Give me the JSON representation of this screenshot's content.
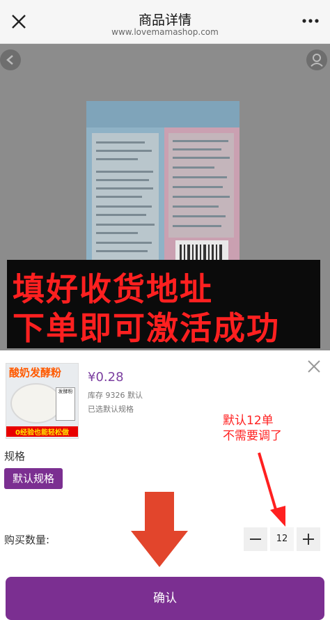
{
  "header": {
    "title": "商品详情",
    "subtitle": "www.lovemamashop.com"
  },
  "banner": {
    "line1": "填好收货地址",
    "line2": "下单即可激活成功"
  },
  "sheet": {
    "thumb_title": "酸奶发酵粉",
    "thumb_box": "发酵粉",
    "thumb_caption": "0经验也能轻松做",
    "price": "¥0.28",
    "stock": "库存 9326 默认",
    "selected": "已选默认规格",
    "spec_label": "规格",
    "spec_option": "默认规格",
    "qty_label": "购买数量:",
    "qty_value": "12",
    "confirm": "确认"
  },
  "annotation": {
    "line1": "默认12单",
    "line2": "不需要调了"
  },
  "icons": {
    "close": "close-icon",
    "more": "more-dots-icon",
    "prev": "chevron-left-icon",
    "share": "share-icon",
    "minus": "minus-icon",
    "plus": "plus-icon"
  },
  "colors": {
    "accent": "#7b2f91",
    "annotation_red": "#ff2020",
    "price": "#7b3fa0"
  }
}
